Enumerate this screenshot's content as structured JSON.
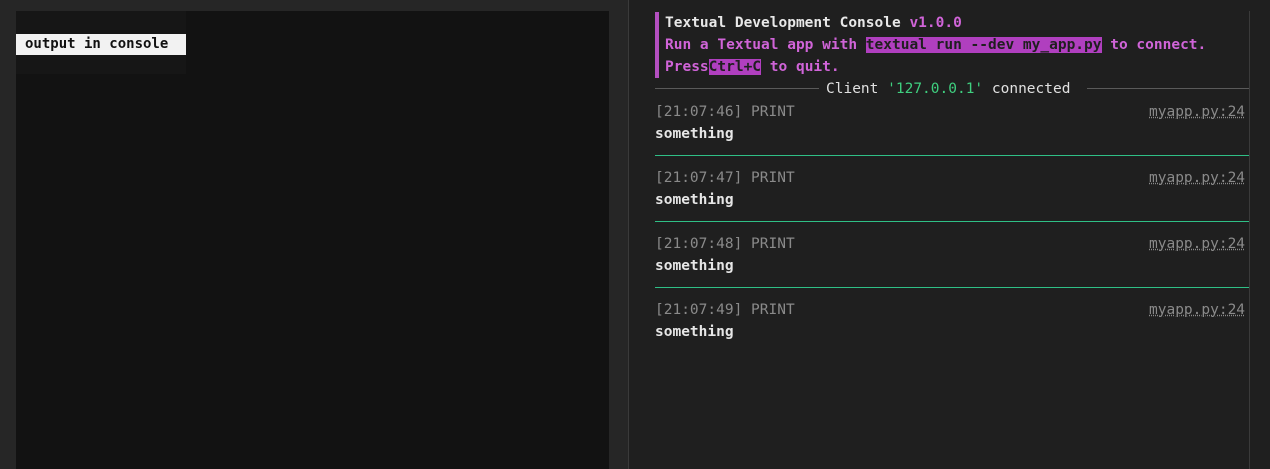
{
  "left_pane": {
    "button_label": "output in console"
  },
  "console": {
    "banner": {
      "title": "Textual Development Console",
      "version": "v1.0.0",
      "line2_prefix": "Run a Textual app with",
      "line2_command": "textual run --dev my_app.py",
      "line2_suffix": "to connect.",
      "line3_prefix": "Press",
      "line3_key": "Ctrl+C",
      "line3_suffix": "to quit."
    },
    "client": {
      "label": "Client",
      "address": "'127.0.0.1'",
      "status": "connected"
    },
    "logs": [
      {
        "time": "[21:07:46]",
        "level": "PRINT",
        "source": "myapp.py:24",
        "message": "something"
      },
      {
        "time": "[21:07:47]",
        "level": "PRINT",
        "source": "myapp.py:24",
        "message": "something"
      },
      {
        "time": "[21:07:48]",
        "level": "PRINT",
        "source": "myapp.py:24",
        "message": "something"
      },
      {
        "time": "[21:07:49]",
        "level": "PRINT",
        "source": "myapp.py:24",
        "message": "something"
      }
    ]
  },
  "colors": {
    "accent_pink": "#b03fbf",
    "accent_green": "#2fbf86",
    "ip_green": "#3fcf7f"
  }
}
